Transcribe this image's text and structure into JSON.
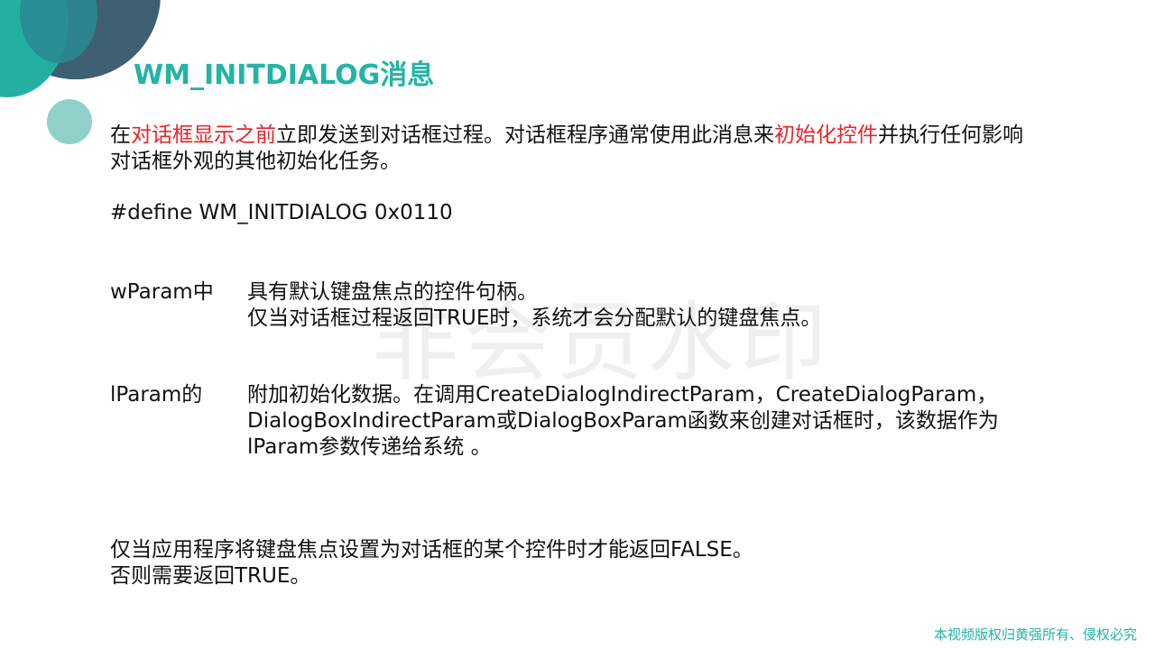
{
  "title": "WM_INITDIALOG消息",
  "intro": {
    "line1": {
      "p1": "在",
      "h1": "对话框显示之前",
      "p2": "立即发送到对话框过程。对话框程序通常使用此消息来",
      "h2": "初始化控件",
      "p3": "并执行任何影响"
    },
    "line2": "对话框外观的其他初始化任务。"
  },
  "define": "#define WM_INITDIALOG 0x0110",
  "wparam": {
    "name": "wParam中",
    "lines": [
      "具有默认键盘焦点的控件句柄。",
      "仅当对话框过程返回TRUE时，系统才会分配默认的键盘焦点。"
    ]
  },
  "lparam": {
    "name": "lParam的",
    "lines": [
      "附加初始化数据。在调用CreateDialogIndirectParam，CreateDialogParam，",
      "DialogBoxIndirectParam或DialogBoxParam函数来创建对话框时，该数据作为",
      "lParam参数传递给系统 。"
    ]
  },
  "final": [
    "仅当应用程序将键盘焦点设置为对话框的某个控件时才能返回FALSE。",
    "否则需要返回TRUE。"
  ],
  "watermark": "非会员水印",
  "footer": "本视频版权归黄强所有、侵权必究",
  "colors": {
    "accent": "#22b4a4",
    "highlight": "#e8242a",
    "dark_circle": "#3f5f73",
    "light_circle": "#8fd1c8"
  }
}
